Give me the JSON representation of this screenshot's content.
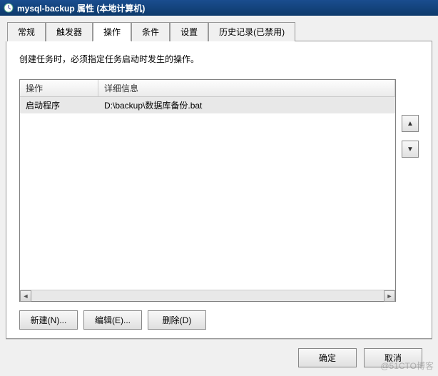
{
  "title": "mysql-backup 属性 (本地计算机)",
  "tabs": [
    {
      "label": "常规"
    },
    {
      "label": "触发器"
    },
    {
      "label": "操作"
    },
    {
      "label": "条件"
    },
    {
      "label": "设置"
    },
    {
      "label": "历史记录(已禁用)"
    }
  ],
  "active_tab_index": 2,
  "panel": {
    "description": "创建任务时，必须指定任务启动时发生的操作。",
    "columns": {
      "action": "操作",
      "details": "详细信息"
    },
    "rows": [
      {
        "action": "启动程序",
        "details": "D:\\backup\\数据库备份.bat"
      }
    ],
    "buttons": {
      "new": "新建(N)...",
      "edit": "编辑(E)...",
      "delete": "删除(D)"
    }
  },
  "dialog_buttons": {
    "ok": "确定",
    "cancel": "取消"
  },
  "side_buttons": {
    "up": "▲",
    "down": "▼"
  },
  "watermark": "@51CTO博客"
}
